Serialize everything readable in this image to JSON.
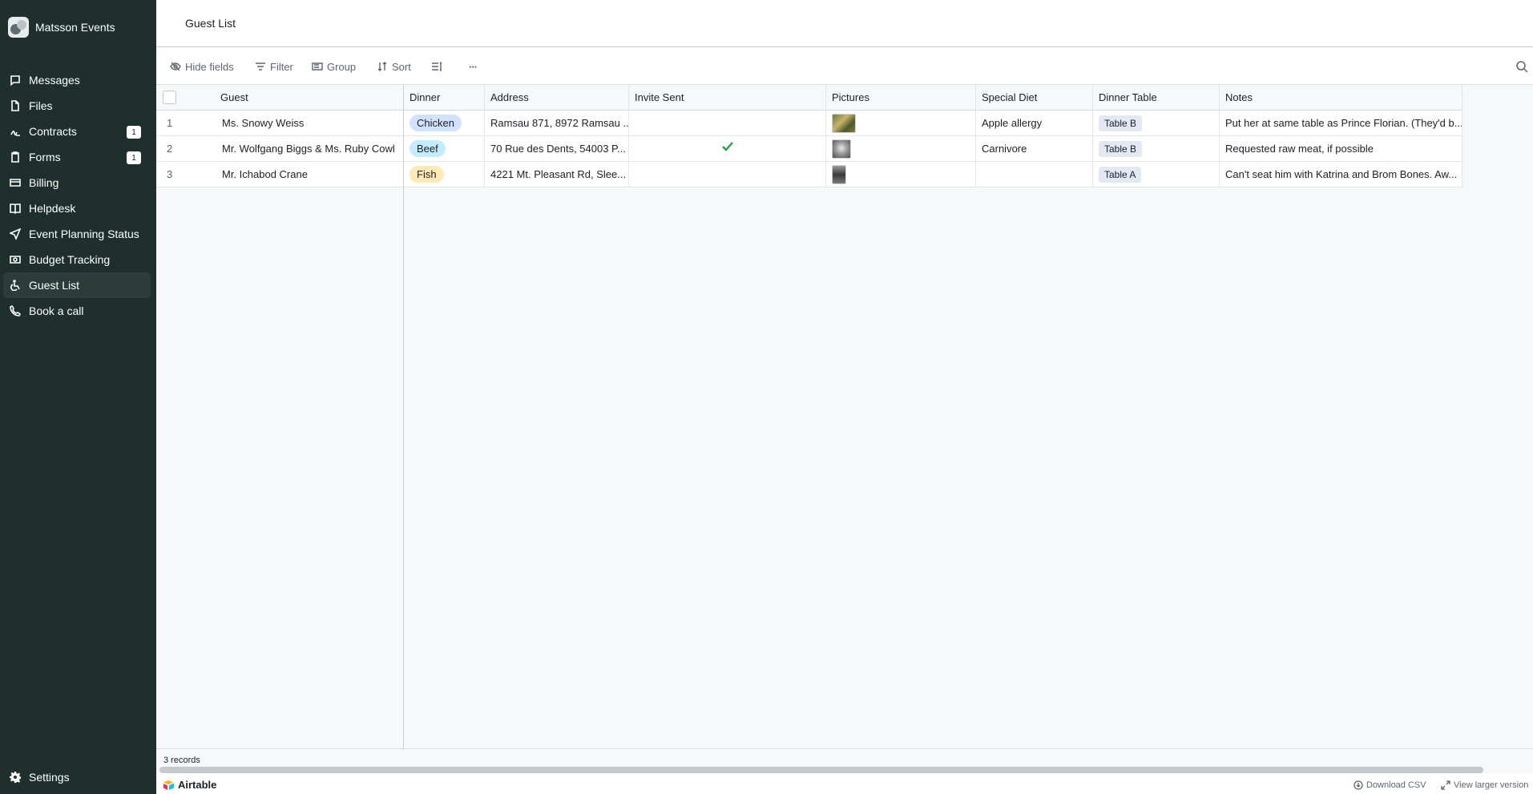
{
  "app": {
    "name": "Matsson Events"
  },
  "sidebar": {
    "items": [
      {
        "label": "Messages",
        "icon": "message-icon"
      },
      {
        "label": "Files",
        "icon": "file-icon"
      },
      {
        "label": "Contracts",
        "icon": "contract-icon",
        "badge": "1"
      },
      {
        "label": "Forms",
        "icon": "clipboard-icon",
        "badge": "1"
      },
      {
        "label": "Billing",
        "icon": "billing-icon"
      },
      {
        "label": "Helpdesk",
        "icon": "book-icon"
      },
      {
        "label": "Event Planning Status",
        "icon": "send-icon"
      },
      {
        "label": "Budget Tracking",
        "icon": "money-icon"
      },
      {
        "label": "Guest List",
        "icon": "wheelchair-icon",
        "active": true
      },
      {
        "label": "Book a call",
        "icon": "phone-icon"
      }
    ],
    "settings_label": "Settings"
  },
  "page": {
    "title": "Guest List"
  },
  "toolbar": {
    "hide_fields": "Hide fields",
    "filter": "Filter",
    "group": "Group",
    "sort": "Sort",
    "more": "···"
  },
  "table": {
    "columns": [
      "Guest",
      "Dinner",
      "Address",
      "Invite Sent",
      "Pictures",
      "Special Diet",
      "Dinner Table",
      "Notes"
    ],
    "rows": [
      {
        "num": "1",
        "guest": "Ms. Snowy Weiss",
        "dinner": "Chicken",
        "dinner_color": "#d1e2ff",
        "address": "Ramsau 871, 8972 Ramsau ...",
        "invite_sent": false,
        "special_diet": "Apple allergy",
        "dinner_table": "Table B",
        "notes": "Put her at same table as Prince Florian. (They'd b..."
      },
      {
        "num": "2",
        "guest": "Mr. Wolfgang Biggs & Ms. Ruby Cowl",
        "dinner": "Beef",
        "dinner_color": "#c4ecff",
        "address": "70 Rue des Dents, 54003 P...",
        "invite_sent": true,
        "special_diet": "Carnivore",
        "dinner_table": "Table B",
        "notes": "Requested raw meat, if possible"
      },
      {
        "num": "3",
        "guest": "Mr. Ichabod Crane",
        "dinner": "Fish",
        "dinner_color": "#ffeab6",
        "address": "4221 Mt. Pleasant Rd, Slee...",
        "invite_sent": false,
        "special_diet": "",
        "dinner_table": "Table A",
        "notes": "Can't seat him with Katrina and Brom Bones. Aw..."
      }
    ]
  },
  "footer": {
    "records": "3 records",
    "brand": "Airtable",
    "download_csv": "Download CSV",
    "view_larger": "View larger version"
  }
}
